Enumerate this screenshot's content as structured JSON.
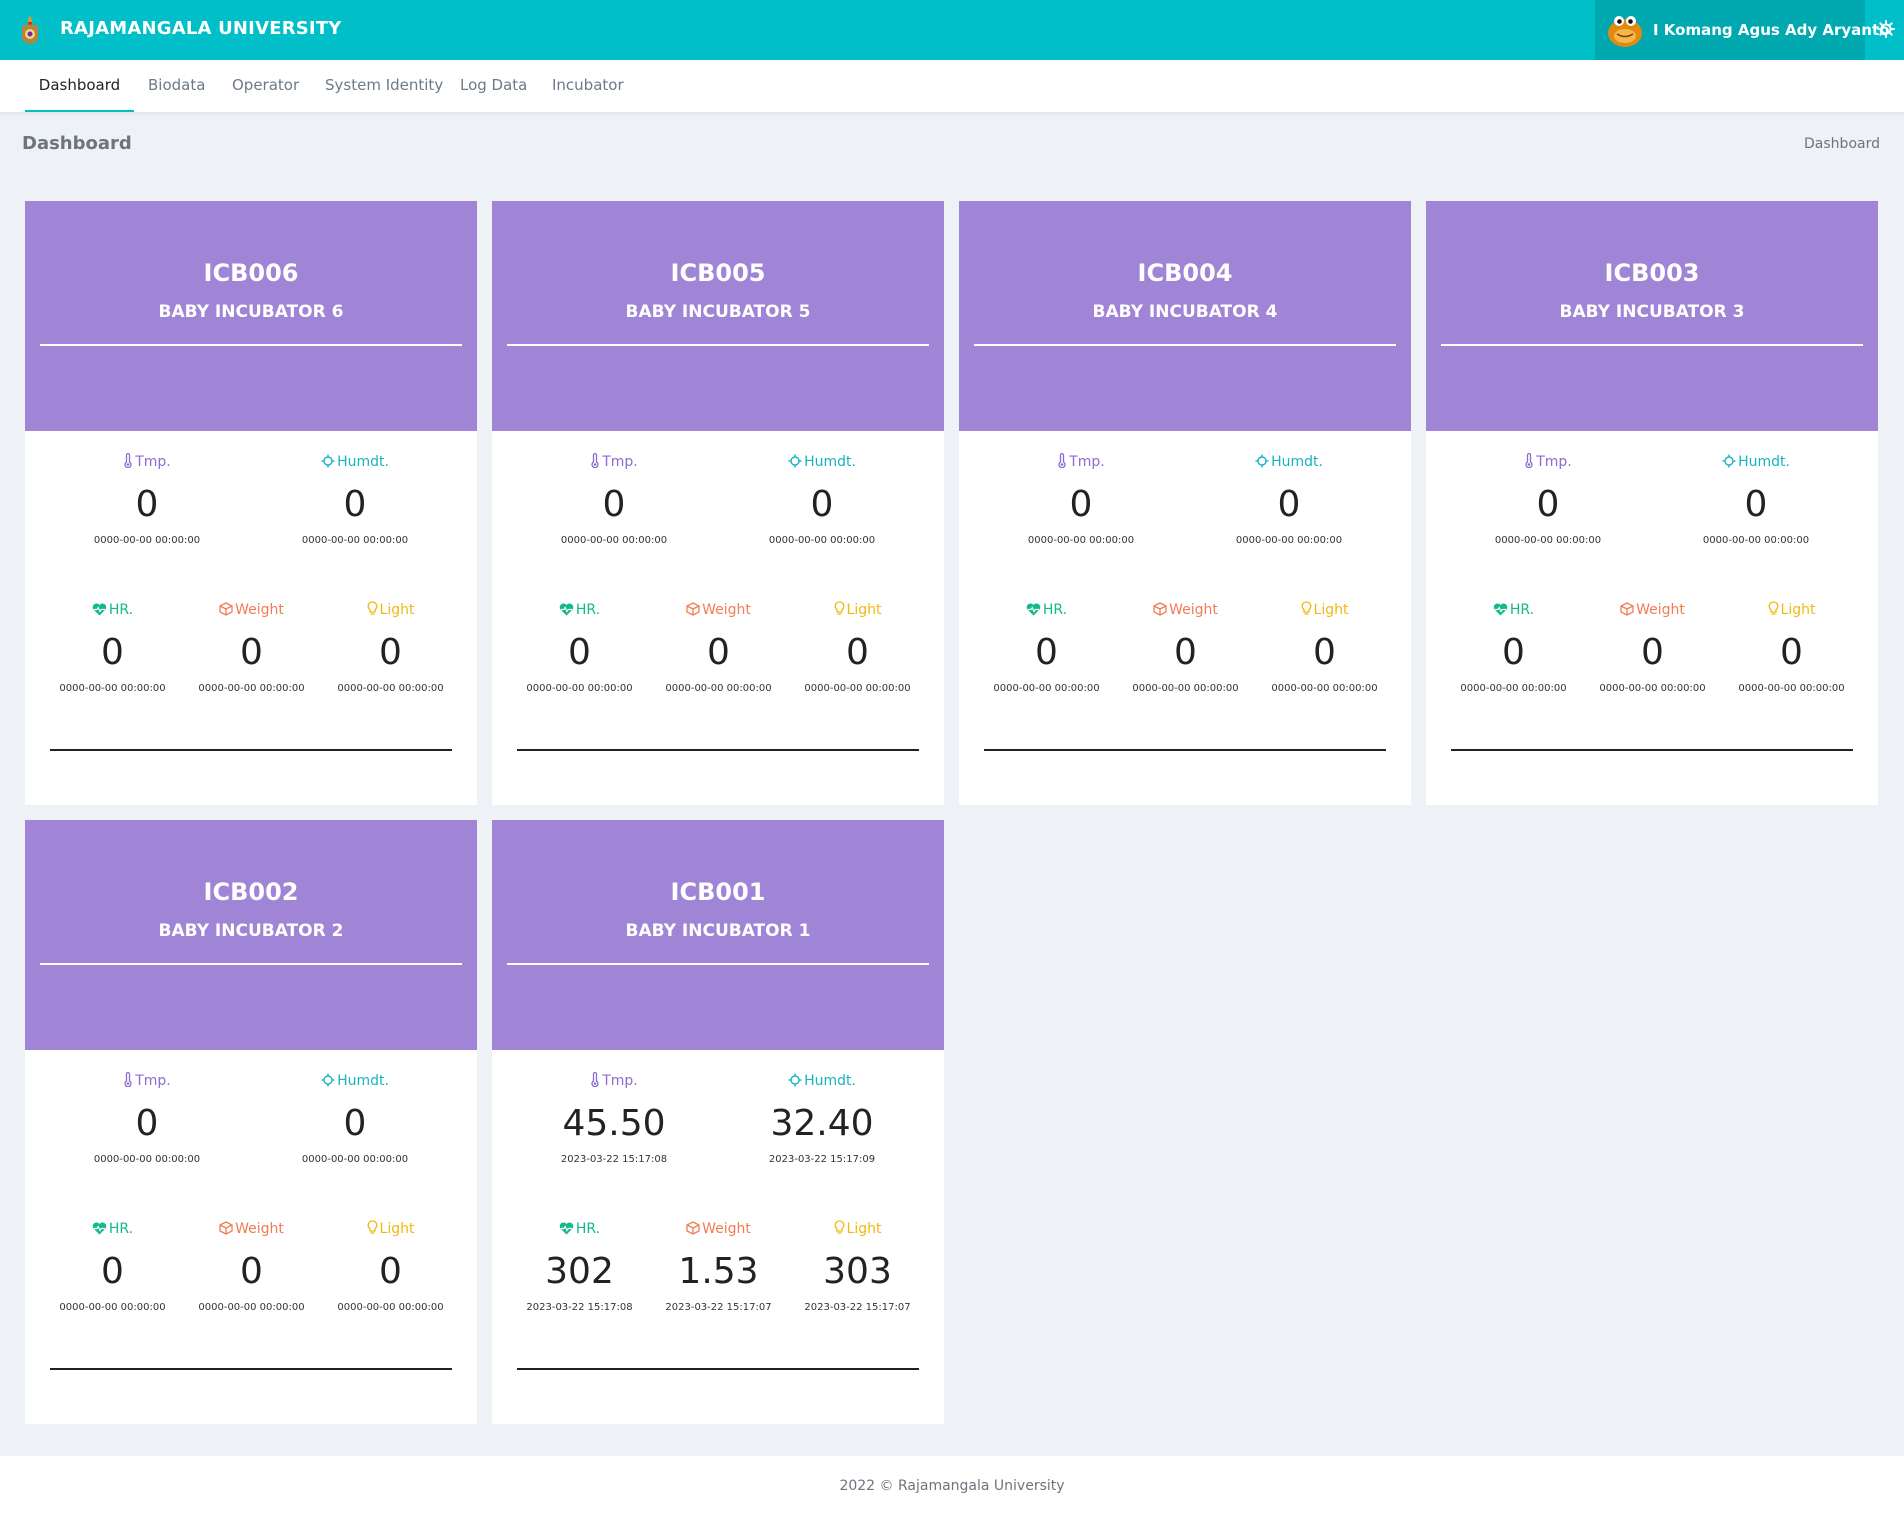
{
  "app": {
    "brand": "RAJAMANGALA UNIVERSITY",
    "user": "I Komang Agus Ady Aryanto"
  },
  "nav": [
    "Dashboard",
    "Biodata",
    "Operator",
    "System Identity",
    "Log Data",
    "Incubator"
  ],
  "page": {
    "title": "Dashboard",
    "breadcrumb": "Dashboard"
  },
  "labels": {
    "tmp": "Tmp.",
    "humdt": "Humdt.",
    "hr": "HR.",
    "weight": "Weight",
    "light": "Light"
  },
  "colors": {
    "topbar": "#00bfc8",
    "card_header": "#a084d5",
    "tmp": "#8d6bd1",
    "humdt": "#17b4c0",
    "hr": "#13b88b",
    "weight": "#f07d55",
    "light": "#f1b90f"
  },
  "cards": [
    {
      "code": "ICB006",
      "name": "BABY INCUBATOR 6",
      "tmp": {
        "value": "0",
        "time": "0000-00-00 00:00:00"
      },
      "humdt": {
        "value": "0",
        "time": "0000-00-00 00:00:00"
      },
      "hr": {
        "value": "0",
        "time": "0000-00-00 00:00:00"
      },
      "weight": {
        "value": "0",
        "time": "0000-00-00 00:00:00"
      },
      "light": {
        "value": "0",
        "time": "0000-00-00 00:00:00"
      }
    },
    {
      "code": "ICB005",
      "name": "BABY INCUBATOR 5",
      "tmp": {
        "value": "0",
        "time": "0000-00-00 00:00:00"
      },
      "humdt": {
        "value": "0",
        "time": "0000-00-00 00:00:00"
      },
      "hr": {
        "value": "0",
        "time": "0000-00-00 00:00:00"
      },
      "weight": {
        "value": "0",
        "time": "0000-00-00 00:00:00"
      },
      "light": {
        "value": "0",
        "time": "0000-00-00 00:00:00"
      }
    },
    {
      "code": "ICB004",
      "name": "BABY INCUBATOR 4",
      "tmp": {
        "value": "0",
        "time": "0000-00-00 00:00:00"
      },
      "humdt": {
        "value": "0",
        "time": "0000-00-00 00:00:00"
      },
      "hr": {
        "value": "0",
        "time": "0000-00-00 00:00:00"
      },
      "weight": {
        "value": "0",
        "time": "0000-00-00 00:00:00"
      },
      "light": {
        "value": "0",
        "time": "0000-00-00 00:00:00"
      }
    },
    {
      "code": "ICB003",
      "name": "BABY INCUBATOR 3",
      "tmp": {
        "value": "0",
        "time": "0000-00-00 00:00:00"
      },
      "humdt": {
        "value": "0",
        "time": "0000-00-00 00:00:00"
      },
      "hr": {
        "value": "0",
        "time": "0000-00-00 00:00:00"
      },
      "weight": {
        "value": "0",
        "time": "0000-00-00 00:00:00"
      },
      "light": {
        "value": "0",
        "time": "0000-00-00 00:00:00"
      }
    },
    {
      "code": "ICB002",
      "name": "BABY INCUBATOR 2",
      "tmp": {
        "value": "0",
        "time": "0000-00-00 00:00:00"
      },
      "humdt": {
        "value": "0",
        "time": "0000-00-00 00:00:00"
      },
      "hr": {
        "value": "0",
        "time": "0000-00-00 00:00:00"
      },
      "weight": {
        "value": "0",
        "time": "0000-00-00 00:00:00"
      },
      "light": {
        "value": "0",
        "time": "0000-00-00 00:00:00"
      }
    },
    {
      "code": "ICB001",
      "name": "BABY INCUBATOR 1",
      "tmp": {
        "value": "45.50",
        "time": "2023-03-22 15:17:08"
      },
      "humdt": {
        "value": "32.40",
        "time": "2023-03-22 15:17:09"
      },
      "hr": {
        "value": "302",
        "time": "2023-03-22 15:17:08"
      },
      "weight": {
        "value": "1.53",
        "time": "2023-03-22 15:17:07"
      },
      "light": {
        "value": "303",
        "time": "2023-03-22 15:17:07"
      }
    }
  ],
  "footer": "2022 © Rajamangala University"
}
